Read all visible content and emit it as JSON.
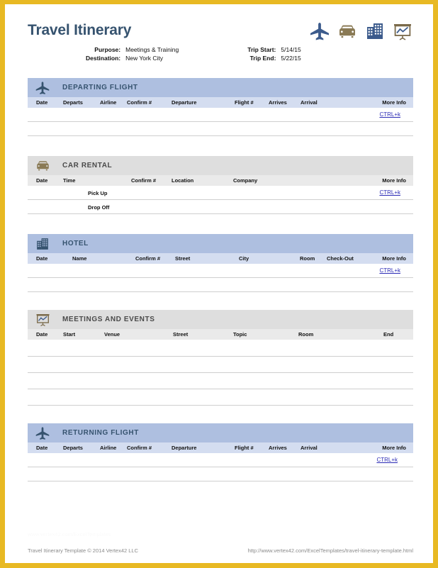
{
  "document": {
    "title": "Travel Itinerary",
    "border_color": "#e8b923",
    "accent_blue": "#aebfe0",
    "accent_blue_light": "#d4ddf0",
    "accent_gray": "#dedede",
    "accent_gray_light": "#eaeaea",
    "title_color": "#36536f",
    "link_color": "#2b2bb5"
  },
  "header": {
    "meta_left": {
      "labels": [
        "Purpose:",
        "Destination:"
      ],
      "values": [
        "Meetings & Training",
        "New York City"
      ]
    },
    "meta_right": {
      "labels": [
        "Trip Start:",
        "Trip End:"
      ],
      "values": [
        "5/14/15",
        "5/22/15"
      ]
    },
    "icons": [
      "airplane-icon",
      "car-icon",
      "building-icon",
      "presentation-chart-icon"
    ]
  },
  "sections": {
    "departing_flight": {
      "title": "DEPARTING FLIGHT",
      "columns": [
        "Date",
        "Departs",
        "Airline",
        "Confirm #",
        "Departure",
        "Flight #",
        "Arrives",
        "Arrival",
        "More Info"
      ],
      "link_label": "CTRL+k"
    },
    "car_rental": {
      "title": "CAR RENTAL",
      "columns": [
        "Date",
        "Time",
        "Confirm #",
        "Location",
        "Company",
        "More Info"
      ],
      "row_labels": [
        "Pick Up",
        "Drop Off"
      ],
      "link_label": "CTRL+k"
    },
    "hotel": {
      "title": "HOTEL",
      "columns": [
        "Date",
        "Name",
        "Confirm #",
        "Street",
        "City",
        "Room",
        "Check-Out",
        "More Info"
      ],
      "link_label": "CTRL+k"
    },
    "meetings": {
      "title": "MEETINGS AND EVENTS",
      "columns": [
        "Date",
        "Start",
        "Venue",
        "Street",
        "Topic",
        "Room",
        "End"
      ]
    },
    "returning_flight": {
      "title": "RETURNING FLIGHT",
      "columns": [
        "Date",
        "Departs",
        "Airline",
        "Confirm #",
        "Departure",
        "Flight #",
        "Arrives",
        "Arrival",
        "More Info"
      ],
      "link_label": "CTRL+k"
    }
  },
  "footer": {
    "copyright": "Travel Itinerary Template © 2014 Vertex42 LLC",
    "url": "http://www.vertex42.com/ExcelTemplates/travel-itinerary-template.html",
    "watermark": "www.vertex42.com/ExcelTemplates"
  }
}
